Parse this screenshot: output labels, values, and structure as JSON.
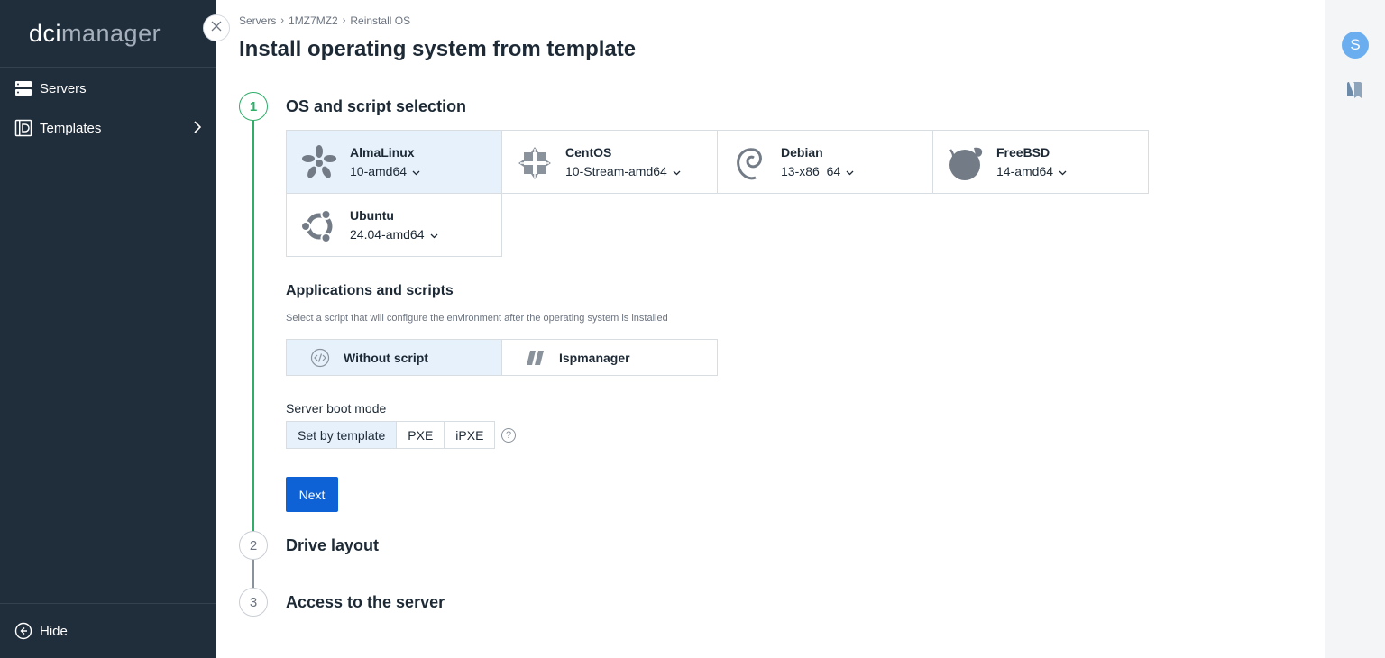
{
  "app": {
    "logo_part1": "dci",
    "logo_part2": "manager"
  },
  "sidebar": {
    "items": [
      {
        "label": "Servers",
        "icon": "server-icon"
      },
      {
        "label": "Templates",
        "icon": "template-icon",
        "has_submenu": true
      }
    ],
    "footer": {
      "label": "Hide",
      "icon": "collapse-icon"
    }
  },
  "user": {
    "initial": "S"
  },
  "breadcrumb": [
    "Servers",
    "1MZ7MZ2",
    "Reinstall OS"
  ],
  "page_title": "Install operating system from template",
  "steps": [
    {
      "number": "1",
      "title": "OS and script selection",
      "active": true
    },
    {
      "number": "2",
      "title": "Drive layout",
      "active": false
    },
    {
      "number": "3",
      "title": "Access to the server",
      "active": false
    }
  ],
  "os_options": [
    {
      "name": "AlmaLinux",
      "version": "10-amd64",
      "icon": "almalinux-icon",
      "selected": true
    },
    {
      "name": "CentOS",
      "version": "10-Stream-amd64",
      "icon": "centos-icon",
      "selected": false
    },
    {
      "name": "Debian",
      "version": "13-x86_64",
      "icon": "debian-icon",
      "selected": false
    },
    {
      "name": "FreeBSD",
      "version": "14-amd64",
      "icon": "freebsd-icon",
      "selected": false
    },
    {
      "name": "Ubuntu",
      "version": "24.04-amd64",
      "icon": "ubuntu-icon",
      "selected": false
    }
  ],
  "scripts": {
    "title": "Applications and scripts",
    "description": "Select a script that will configure the environment after the operating system is installed",
    "options": [
      {
        "label": "Without script",
        "icon": "code-icon",
        "selected": true
      },
      {
        "label": "Ispmanager",
        "icon": "ispmanager-icon",
        "selected": false
      }
    ]
  },
  "boot_mode": {
    "label": "Server boot mode",
    "options": [
      "Set by template",
      "PXE",
      "iPXE"
    ],
    "selected": "Set by template",
    "help": "?"
  },
  "next_button": "Next",
  "colors": {
    "sidebar_bg": "#202d3b",
    "accent": "#0f62d6",
    "step_active": "#2fae6a",
    "selected_bg": "#e6f1fc"
  }
}
